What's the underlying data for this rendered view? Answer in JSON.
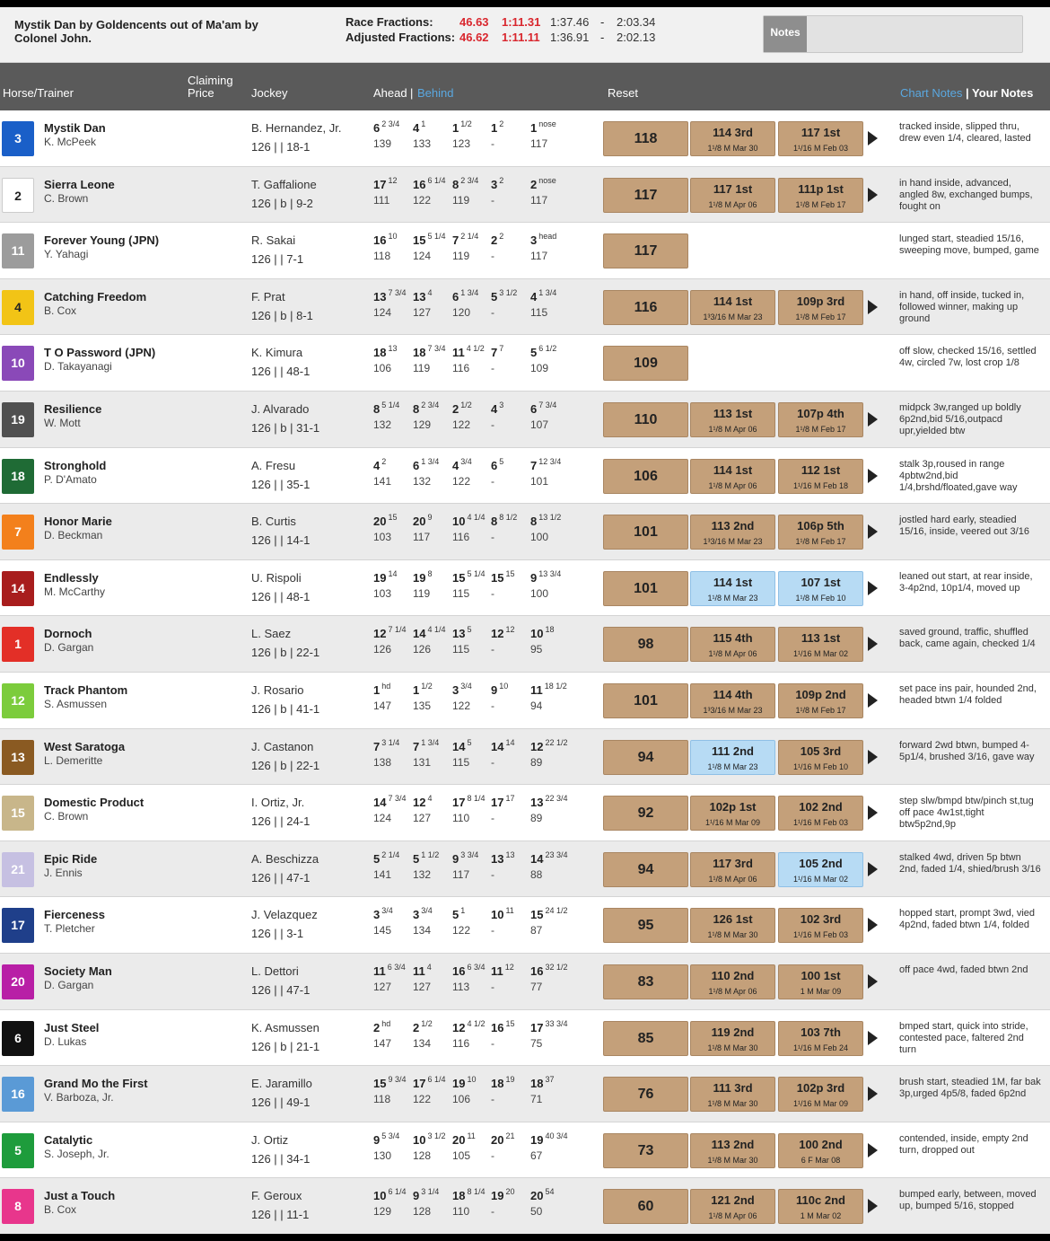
{
  "pedigree": "Mystik Dan by Goldencents out of Ma'am by Colonel John.",
  "fractions": {
    "race_label": "Race Fractions:",
    "race": [
      "46.63",
      "1:11.31",
      "1:37.46",
      "-",
      "2:03.34"
    ],
    "adjusted_label": "Adjusted Fractions:",
    "adjusted": [
      "46.62",
      "1:11.11",
      "1:36.91",
      "-",
      "2:02.13"
    ]
  },
  "notes_button": "Notes",
  "header": {
    "horse_trainer": "Horse/Trainer",
    "claiming_top": "Claiming",
    "claiming_bottom": "Price",
    "jockey": "Jockey",
    "ahead": "Ahead",
    "sep": "|",
    "behind": "Behind",
    "reset": "Reset",
    "chart_notes": "Chart Notes",
    "your_notes": "Your Notes"
  },
  "colors": {
    "tan": "#c4a07a",
    "light_blue": "#b7dbf4",
    "header_bg": "#5a5a5a",
    "fraction_red": "#d9272e"
  },
  "rows": [
    {
      "pp": "3",
      "pp_color": "#1a5fc8",
      "pp_text": "#ffffff",
      "horse": "Mystik Dan",
      "trainer": "K. McPeek",
      "jockey": "B. Hernandez, Jr.",
      "wt": "126 |  | 18-1",
      "calls": [
        {
          "p": "6",
          "m": "2 3/4",
          "f": "139"
        },
        {
          "p": "4",
          "m": "1",
          "f": "133"
        },
        {
          "p": "1",
          "m": "1/2",
          "f": "123"
        },
        {
          "p": "1",
          "m": "2",
          "f": "-"
        },
        {
          "p": "1",
          "m": "nose",
          "f": "117"
        }
      ],
      "fig": "118",
      "r1": {
        "t": "114  3rd",
        "s": "1¹/8  M Mar 30",
        "c": "tan"
      },
      "r2": {
        "t": "117  1st",
        "s": "1¹/16  M Feb 03",
        "c": "tan"
      },
      "comment": "tracked inside, slipped thru, drew even 1/4, cleared, lasted"
    },
    {
      "pp": "2",
      "pp_color": "#ffffff",
      "pp_text": "#222222",
      "horse": "Sierra Leone",
      "trainer": "C. Brown",
      "jockey": "T. Gaffalione",
      "wt": "126 | b | 9-2",
      "calls": [
        {
          "p": "17",
          "m": "12",
          "f": "111"
        },
        {
          "p": "16",
          "m": "6 1/4",
          "f": "122"
        },
        {
          "p": "8",
          "m": "2 3/4",
          "f": "119"
        },
        {
          "p": "3",
          "m": "2",
          "f": "-"
        },
        {
          "p": "2",
          "m": "nose",
          "f": "117"
        }
      ],
      "fig": "117",
      "r1": {
        "t": "117  1st",
        "s": "1¹/8  M Apr 06",
        "c": "tan"
      },
      "r2": {
        "t": "111p  1st",
        "s": "1¹/8  M Feb 17",
        "c": "tan"
      },
      "comment": "in hand inside, advanced, angled 8w, exchanged bumps, fought on"
    },
    {
      "pp": "11",
      "pp_color": "#9c9c9c",
      "pp_text": "#ffffff",
      "horse": "Forever Young (JPN)",
      "trainer": "Y. Yahagi",
      "jockey": "R. Sakai",
      "wt": "126 |  | 7-1",
      "calls": [
        {
          "p": "16",
          "m": "10",
          "f": "118"
        },
        {
          "p": "15",
          "m": "5 1/4",
          "f": "124"
        },
        {
          "p": "7",
          "m": "2 1/4",
          "f": "119"
        },
        {
          "p": "2",
          "m": "2",
          "f": "-"
        },
        {
          "p": "3",
          "m": "head",
          "f": "117"
        }
      ],
      "fig": "117",
      "r1": null,
      "r2": null,
      "comment": "lunged start, steadied 15/16, sweeping move, bumped, game"
    },
    {
      "pp": "4",
      "pp_color": "#f2c416",
      "pp_text": "#222222",
      "horse": "Catching Freedom",
      "trainer": "B. Cox",
      "jockey": "F. Prat",
      "wt": "126 | b | 8-1",
      "calls": [
        {
          "p": "13",
          "m": "7 3/4",
          "f": "124"
        },
        {
          "p": "13",
          "m": "4",
          "f": "127"
        },
        {
          "p": "6",
          "m": "1 3/4",
          "f": "120"
        },
        {
          "p": "5",
          "m": "3 1/2",
          "f": "-"
        },
        {
          "p": "4",
          "m": "1 3/4",
          "f": "115"
        }
      ],
      "fig": "116",
      "r1": {
        "t": "114  1st",
        "s": "1³3/16  M Mar 23",
        "c": "tan"
      },
      "r2": {
        "t": "109p  3rd",
        "s": "1¹/8  M Feb 17",
        "c": "tan"
      },
      "comment": "in hand, off inside, tucked in, followed winner, making up ground"
    },
    {
      "pp": "10",
      "pp_color": "#8a49b8",
      "pp_text": "#ffffff",
      "horse": "T O Password (JPN)",
      "trainer": "D. Takayanagi",
      "jockey": "K. Kimura",
      "wt": "126 |  | 48-1",
      "calls": [
        {
          "p": "18",
          "m": "13",
          "f": "106"
        },
        {
          "p": "18",
          "m": "7 3/4",
          "f": "119"
        },
        {
          "p": "11",
          "m": "4 1/2",
          "f": "116"
        },
        {
          "p": "7",
          "m": "7",
          "f": "-"
        },
        {
          "p": "5",
          "m": "6 1/2",
          "f": "109"
        }
      ],
      "fig": "109",
      "r1": null,
      "r2": null,
      "comment": "off slow, checked 15/16, settled 4w, circled 7w, lost crop 1/8"
    },
    {
      "pp": "19",
      "pp_color": "#505050",
      "pp_text": "#ffffff",
      "horse": "Resilience",
      "trainer": "W. Mott",
      "jockey": "J. Alvarado",
      "wt": "126 | b | 31-1",
      "calls": [
        {
          "p": "8",
          "m": "5 1/4",
          "f": "132"
        },
        {
          "p": "8",
          "m": "2 3/4",
          "f": "129"
        },
        {
          "p": "2",
          "m": "1/2",
          "f": "122"
        },
        {
          "p": "4",
          "m": "3",
          "f": "-"
        },
        {
          "p": "6",
          "m": "7 3/4",
          "f": "107"
        }
      ],
      "fig": "110",
      "r1": {
        "t": "113  1st",
        "s": "1¹/8  M Apr 06",
        "c": "tan"
      },
      "r2": {
        "t": "107p  4th",
        "s": "1¹/8  M Feb 17",
        "c": "tan"
      },
      "comment": "midpck 3w,ranged up boldly 6p2nd,bid 5/16,outpacd upr,yielded btw"
    },
    {
      "pp": "18",
      "pp_color": "#1f6b35",
      "pp_text": "#ffffff",
      "horse": "Stronghold",
      "trainer": "P. D'Amato",
      "jockey": "A. Fresu",
      "wt": "126 |  | 35-1",
      "calls": [
        {
          "p": "4",
          "m": "2",
          "f": "141"
        },
        {
          "p": "6",
          "m": "1 3/4",
          "f": "132"
        },
        {
          "p": "4",
          "m": "3/4",
          "f": "122"
        },
        {
          "p": "6",
          "m": "5",
          "f": "-"
        },
        {
          "p": "7",
          "m": "12 3/4",
          "f": "101"
        }
      ],
      "fig": "106",
      "r1": {
        "t": "114  1st",
        "s": "1¹/8  M Apr 06",
        "c": "tan"
      },
      "r2": {
        "t": "112  1st",
        "s": "1¹/16  M Feb 18",
        "c": "tan"
      },
      "comment": "stalk 3p,roused in range 4pbtw2nd,bid 1/4,brshd/floated,gave way"
    },
    {
      "pp": "7",
      "pp_color": "#f3801c",
      "pp_text": "#ffffff",
      "horse": "Honor Marie",
      "trainer": "D. Beckman",
      "jockey": "B. Curtis",
      "wt": "126 |  | 14-1",
      "calls": [
        {
          "p": "20",
          "m": "15",
          "f": "103"
        },
        {
          "p": "20",
          "m": "9",
          "f": "117"
        },
        {
          "p": "10",
          "m": "4 1/4",
          "f": "116"
        },
        {
          "p": "8",
          "m": "8 1/2",
          "f": "-"
        },
        {
          "p": "8",
          "m": "13 1/2",
          "f": "100"
        }
      ],
      "fig": "101",
      "r1": {
        "t": "113  2nd",
        "s": "1³3/16  M Mar 23",
        "c": "tan"
      },
      "r2": {
        "t": "106p  5th",
        "s": "1¹/8  M Feb 17",
        "c": "tan"
      },
      "comment": "jostled hard early, steadied 15/16, inside, veered out 3/16"
    },
    {
      "pp": "14",
      "pp_color": "#a81d1d",
      "pp_text": "#ffffff",
      "horse": "Endlessly",
      "trainer": "M. McCarthy",
      "jockey": "U. Rispoli",
      "wt": "126 |  | 48-1",
      "calls": [
        {
          "p": "19",
          "m": "14",
          "f": "103"
        },
        {
          "p": "19",
          "m": "8",
          "f": "119"
        },
        {
          "p": "15",
          "m": "5 1/4",
          "f": "115"
        },
        {
          "p": "15",
          "m": "15",
          "f": "-"
        },
        {
          "p": "9",
          "m": "13 3/4",
          "f": "100"
        }
      ],
      "fig": "101",
      "r1": {
        "t": "114  1st",
        "s": "1¹/8  M Mar 23",
        "c": "blue"
      },
      "r2": {
        "t": "107  1st",
        "s": "1¹/8  M Feb 10",
        "c": "blue"
      },
      "comment": "leaned out start, at rear inside, 3-4p2nd, 10p1/4, moved up"
    },
    {
      "pp": "1",
      "pp_color": "#e32f27",
      "pp_text": "#ffffff",
      "horse": "Dornoch",
      "trainer": "D. Gargan",
      "jockey": "L. Saez",
      "wt": "126 | b | 22-1",
      "calls": [
        {
          "p": "12",
          "m": "7 1/4",
          "f": "126"
        },
        {
          "p": "14",
          "m": "4 1/4",
          "f": "126"
        },
        {
          "p": "13",
          "m": "5",
          "f": "115"
        },
        {
          "p": "12",
          "m": "12",
          "f": "-"
        },
        {
          "p": "10",
          "m": "18",
          "f": "95"
        }
      ],
      "fig": "98",
      "r1": {
        "t": "115  4th",
        "s": "1¹/8  M Apr 06",
        "c": "tan"
      },
      "r2": {
        "t": "113  1st",
        "s": "1¹/16  M Mar 02",
        "c": "tan"
      },
      "comment": "saved ground, traffic, shuffled back, came again, checked 1/4"
    },
    {
      "pp": "12",
      "pp_color": "#7ccc3c",
      "pp_text": "#ffffff",
      "horse": "Track Phantom",
      "trainer": "S. Asmussen",
      "jockey": "J. Rosario",
      "wt": "126 | b | 41-1",
      "calls": [
        {
          "p": "1",
          "m": "hd",
          "f": "147"
        },
        {
          "p": "1",
          "m": "1/2",
          "f": "135"
        },
        {
          "p": "3",
          "m": "3/4",
          "f": "122"
        },
        {
          "p": "9",
          "m": "10",
          "f": "-"
        },
        {
          "p": "11",
          "m": "18 1/2",
          "f": "94"
        }
      ],
      "fig": "101",
      "r1": {
        "t": "114  4th",
        "s": "1³3/16  M Mar 23",
        "c": "tan"
      },
      "r2": {
        "t": "109p  2nd",
        "s": "1¹/8  M Feb 17",
        "c": "tan"
      },
      "comment": "set pace ins pair, hounded 2nd, headed btwn 1/4 folded"
    },
    {
      "pp": "13",
      "pp_color": "#8a5a22",
      "pp_text": "#ffffff",
      "horse": "West Saratoga",
      "trainer": "L. Demeritte",
      "jockey": "J. Castanon",
      "wt": "126 | b | 22-1",
      "calls": [
        {
          "p": "7",
          "m": "3 1/4",
          "f": "138"
        },
        {
          "p": "7",
          "m": "1 3/4",
          "f": "131"
        },
        {
          "p": "14",
          "m": "5",
          "f": "115"
        },
        {
          "p": "14",
          "m": "14",
          "f": "-"
        },
        {
          "p": "12",
          "m": "22 1/2",
          "f": "89"
        }
      ],
      "fig": "94",
      "r1": {
        "t": "111  2nd",
        "s": "1¹/8  M Mar 23",
        "c": "blue"
      },
      "r2": {
        "t": "105  3rd",
        "s": "1¹/16  M Feb 10",
        "c": "tan"
      },
      "comment": "forward 2wd btwn, bumped 4-5p1/4, brushed 3/16, gave way"
    },
    {
      "pp": "15",
      "pp_color": "#c8b68a",
      "pp_text": "#ffffff",
      "horse": "Domestic Product",
      "trainer": "C. Brown",
      "jockey": "I. Ortiz, Jr.",
      "wt": "126 |  | 24-1",
      "calls": [
        {
          "p": "14",
          "m": "7 3/4",
          "f": "124"
        },
        {
          "p": "12",
          "m": "4",
          "f": "127"
        },
        {
          "p": "17",
          "m": "8 1/4",
          "f": "110"
        },
        {
          "p": "17",
          "m": "17",
          "f": "-"
        },
        {
          "p": "13",
          "m": "22 3/4",
          "f": "89"
        }
      ],
      "fig": "92",
      "r1": {
        "t": "102p  1st",
        "s": "1¹/16  M Mar 09",
        "c": "tan"
      },
      "r2": {
        "t": "102  2nd",
        "s": "1¹/16  M Feb 03",
        "c": "tan"
      },
      "comment": "step slw/bmpd btw/pinch st,tug off pace 4w1st,tight btw5p2nd,9p"
    },
    {
      "pp": "21",
      "pp_color": "#c6c0e2",
      "pp_text": "#ffffff",
      "horse": "Epic Ride",
      "trainer": "J. Ennis",
      "jockey": "A. Beschizza",
      "wt": "126 |  | 47-1",
      "calls": [
        {
          "p": "5",
          "m": "2 1/4",
          "f": "141"
        },
        {
          "p": "5",
          "m": "1 1/2",
          "f": "132"
        },
        {
          "p": "9",
          "m": "3 3/4",
          "f": "117"
        },
        {
          "p": "13",
          "m": "13",
          "f": "-"
        },
        {
          "p": "14",
          "m": "23 3/4",
          "f": "88"
        }
      ],
      "fig": "94",
      "r1": {
        "t": "117  3rd",
        "s": "1¹/8  M Apr 06",
        "c": "tan"
      },
      "r2": {
        "t": "105  2nd",
        "s": "1¹/16  M Mar 02",
        "c": "blue"
      },
      "comment": "stalked 4wd, driven 5p btwn 2nd, faded 1/4, shied/brush 3/16"
    },
    {
      "pp": "17",
      "pp_color": "#1f3f8a",
      "pp_text": "#ffffff",
      "horse": "Fierceness",
      "trainer": "T. Pletcher",
      "jockey": "J. Velazquez",
      "wt": "126 |  | 3-1",
      "calls": [
        {
          "p": "3",
          "m": "3/4",
          "f": "145"
        },
        {
          "p": "3",
          "m": "3/4",
          "f": "134"
        },
        {
          "p": "5",
          "m": "1",
          "f": "122"
        },
        {
          "p": "10",
          "m": "11",
          "f": "-"
        },
        {
          "p": "15",
          "m": "24 1/2",
          "f": "87"
        }
      ],
      "fig": "95",
      "r1": {
        "t": "126  1st",
        "s": "1¹/8  M Mar 30",
        "c": "tan"
      },
      "r2": {
        "t": "102  3rd",
        "s": "1¹/16  M Feb 03",
        "c": "tan"
      },
      "comment": "hopped start, prompt 3wd, vied 4p2nd, faded btwn 1/4, folded"
    },
    {
      "pp": "20",
      "pp_color": "#b81fa6",
      "pp_text": "#ffffff",
      "horse": "Society Man",
      "trainer": "D. Gargan",
      "jockey": "L. Dettori",
      "wt": "126 |  | 47-1",
      "calls": [
        {
          "p": "11",
          "m": "6 3/4",
          "f": "127"
        },
        {
          "p": "11",
          "m": "4",
          "f": "127"
        },
        {
          "p": "16",
          "m": "6 3/4",
          "f": "113"
        },
        {
          "p": "11",
          "m": "12",
          "f": "-"
        },
        {
          "p": "16",
          "m": "32 1/2",
          "f": "77"
        }
      ],
      "fig": "83",
      "r1": {
        "t": "110  2nd",
        "s": "1¹/8  M Apr 06",
        "c": "tan"
      },
      "r2": {
        "t": "100  1st",
        "s": "1  M Mar 09",
        "c": "tan"
      },
      "comment": "off pace 4wd, faded btwn 2nd"
    },
    {
      "pp": "6",
      "pp_color": "#111111",
      "pp_text": "#ffffff",
      "horse": "Just Steel",
      "trainer": "D. Lukas",
      "jockey": "K. Asmussen",
      "wt": "126 | b | 21-1",
      "calls": [
        {
          "p": "2",
          "m": "hd",
          "f": "147"
        },
        {
          "p": "2",
          "m": "1/2",
          "f": "134"
        },
        {
          "p": "12",
          "m": "4 1/2",
          "f": "116"
        },
        {
          "p": "16",
          "m": "15",
          "f": "-"
        },
        {
          "p": "17",
          "m": "33 3/4",
          "f": "75"
        }
      ],
      "fig": "85",
      "r1": {
        "t": "119  2nd",
        "s": "1¹/8  M Mar 30",
        "c": "tan"
      },
      "r2": {
        "t": "103  7th",
        "s": "1¹/16  M Feb 24",
        "c": "tan"
      },
      "comment": "bmped start, quick into stride, contested pace, faltered 2nd turn"
    },
    {
      "pp": "16",
      "pp_color": "#5a9ad6",
      "pp_text": "#ffffff",
      "horse": "Grand Mo the First",
      "trainer": "V. Barboza, Jr.",
      "jockey": "E. Jaramillo",
      "wt": "126 |  | 49-1",
      "calls": [
        {
          "p": "15",
          "m": "9 3/4",
          "f": "118"
        },
        {
          "p": "17",
          "m": "6 1/4",
          "f": "122"
        },
        {
          "p": "19",
          "m": "10",
          "f": "106"
        },
        {
          "p": "18",
          "m": "19",
          "f": "-"
        },
        {
          "p": "18",
          "m": "37",
          "f": "71"
        }
      ],
      "fig": "76",
      "r1": {
        "t": "111  3rd",
        "s": "1¹/8  M Mar 30",
        "c": "tan"
      },
      "r2": {
        "t": "102p  3rd",
        "s": "1¹/16  M Mar 09",
        "c": "tan"
      },
      "comment": "brush start, steadied 1M, far bak 3p,urged 4p5/8, faded 6p2nd"
    },
    {
      "pp": "5",
      "pp_color": "#1e9c3c",
      "pp_text": "#ffffff",
      "horse": "Catalytic",
      "trainer": "S. Joseph, Jr.",
      "jockey": "J. Ortiz",
      "wt": "126 |  | 34-1",
      "calls": [
        {
          "p": "9",
          "m": "5 3/4",
          "f": "130"
        },
        {
          "p": "10",
          "m": "3 1/2",
          "f": "128"
        },
        {
          "p": "20",
          "m": "11",
          "f": "105"
        },
        {
          "p": "20",
          "m": "21",
          "f": "-"
        },
        {
          "p": "19",
          "m": "40 3/4",
          "f": "67"
        }
      ],
      "fig": "73",
      "r1": {
        "t": "113  2nd",
        "s": "1¹/8  M Mar 30",
        "c": "tan"
      },
      "r2": {
        "t": "100  2nd",
        "s": "6  F Mar 08",
        "c": "tan"
      },
      "comment": "contended, inside, empty 2nd turn, dropped out"
    },
    {
      "pp": "8",
      "pp_color": "#e8368c",
      "pp_text": "#ffffff",
      "horse": "Just a Touch",
      "trainer": "B. Cox",
      "jockey": "F. Geroux",
      "wt": "126 |  | 11-1",
      "calls": [
        {
          "p": "10",
          "m": "6 1/4",
          "f": "129"
        },
        {
          "p": "9",
          "m": "3 1/4",
          "f": "128"
        },
        {
          "p": "18",
          "m": "8 1/4",
          "f": "110"
        },
        {
          "p": "19",
          "m": "20",
          "f": "-"
        },
        {
          "p": "20",
          "m": "54",
          "f": "50"
        }
      ],
      "fig": "60",
      "r1": {
        "t": "121  2nd",
        "s": "1¹/8  M Apr 06",
        "c": "tan"
      },
      "r2": {
        "t": "110c  2nd",
        "s": "1  M Mar 02",
        "c": "tan"
      },
      "comment": "bumped early, between, moved up, bumped 5/16, stopped"
    }
  ]
}
